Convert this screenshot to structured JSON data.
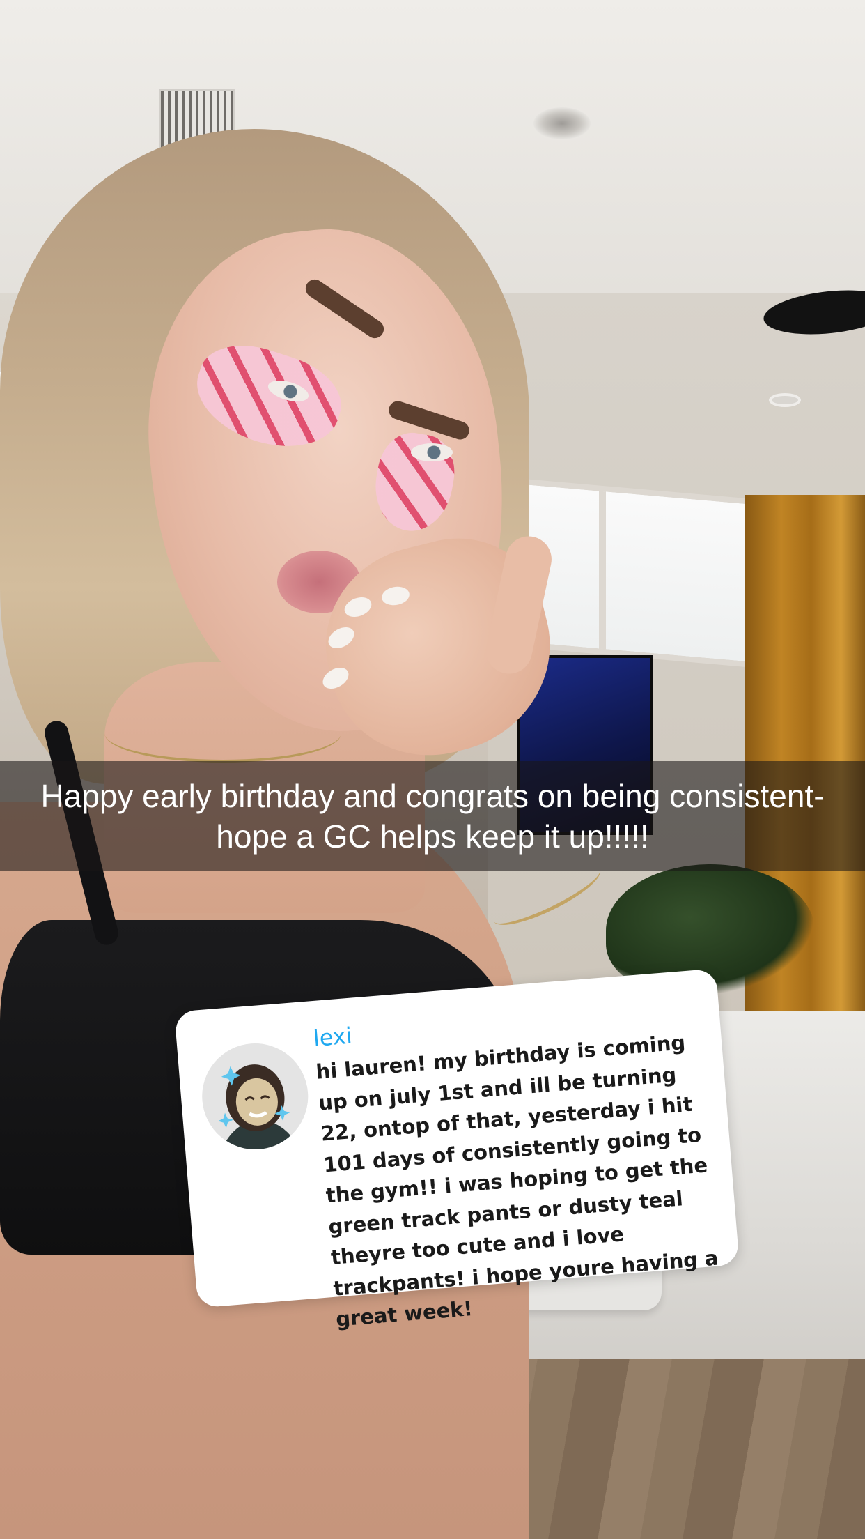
{
  "story": {
    "caption": "Happy early birthday and congrats on being consistent- hope a GC helps keep it up!!!!!"
  },
  "message_card": {
    "sender": "lexi",
    "avatar_icon": "bitmoji-avatar",
    "message": "hi lauren! my birthday is coming up on july 1st and ill be turning 22, ontop of that, yesterday i hit 101 days of consistently going to the gym!! i was hoping to get the green track pants or dusty teal theyre too cute and i love trackpants! i hope youre having a great week!"
  },
  "colors": {
    "sender_name": "#1fa8f0",
    "caption_background": "rgba(25,22,22,0.58)",
    "card_background": "#ffffff"
  }
}
